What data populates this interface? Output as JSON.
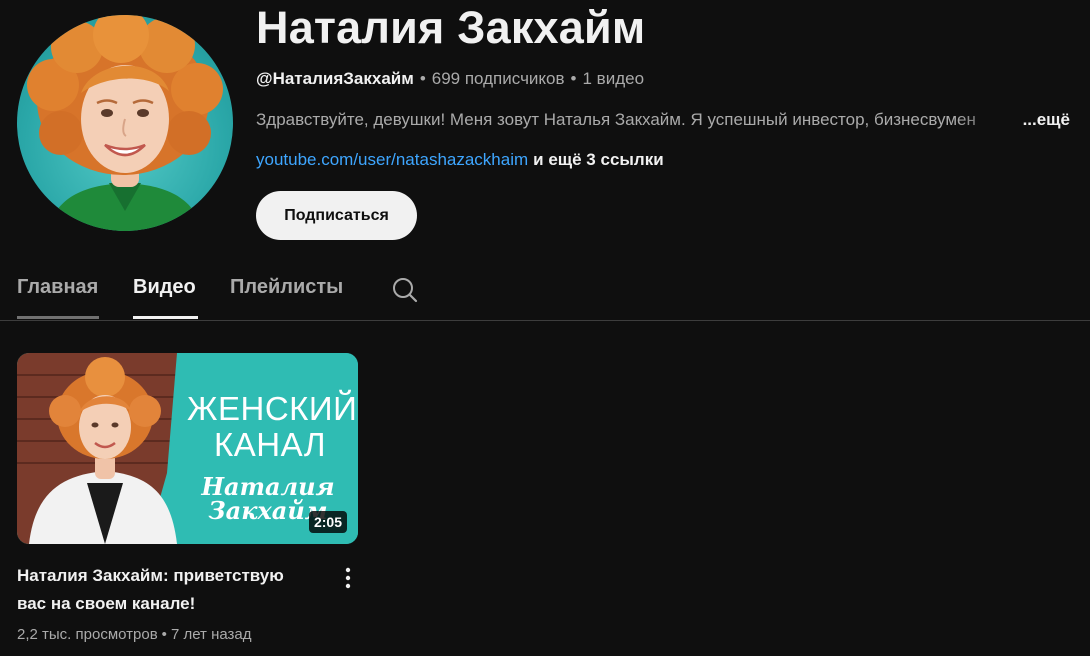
{
  "channel": {
    "name": "Наталия Закхайм",
    "handle": "@НаталияЗакхайм",
    "subscribers": "699 подписчиков",
    "videos_count": "1 видео",
    "meta_separator": "•",
    "description": "Здравствуйте, девушки! Меня зовут Наталья Закхайм. Я успешный инвестор, бизнесвумен",
    "description_more": "...ещё",
    "link": "youtube.com/user/natashazackhaim",
    "more_links": "и ещё 3 ссылки",
    "subscribe_label": "Подписаться"
  },
  "tabs": [
    {
      "label": "Главная",
      "state": "hover"
    },
    {
      "label": "Видео",
      "state": "active"
    },
    {
      "label": "Плейлисты",
      "state": "normal"
    }
  ],
  "icons": {
    "search": "search-icon",
    "more": "more-vert-icon"
  },
  "video": {
    "thumbnail_title": "ЖЕНСКИЙ\nКАНАЛ",
    "thumbnail_signature": "Наталия\nЗакхайм",
    "duration": "2:05",
    "title": "Наталия Закхайм: приветствую вас на своем канале!",
    "views": "2,2 тыс. просмотров",
    "age": "7 лет назад",
    "meta_separator": "•"
  },
  "colors": {
    "background": "#0f0f0f",
    "link": "#3ea6ff",
    "thumbnail_teal": "#2fbcb3",
    "avatar_teal": "#2aa7a8"
  }
}
